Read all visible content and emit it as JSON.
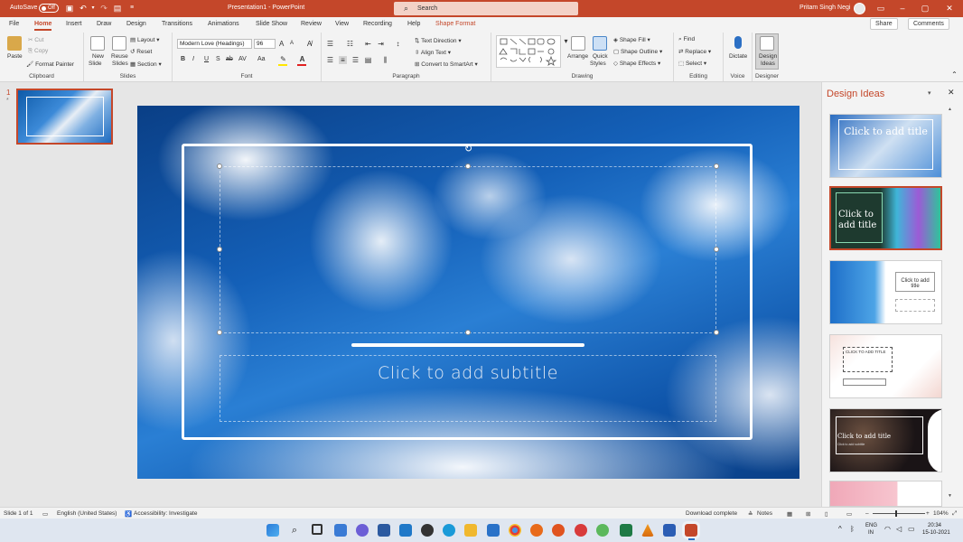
{
  "titlebar": {
    "autosave": "AutoSave",
    "autosave_state": "Off",
    "title": "Presentation1 - PowerPoint",
    "search": "Search",
    "user": "Pritam Singh Negi"
  },
  "tabs": [
    "File",
    "Home",
    "Insert",
    "Draw",
    "Design",
    "Transitions",
    "Animations",
    "Slide Show",
    "Review",
    "View",
    "Recording",
    "Help",
    "Shape Format"
  ],
  "tab_buttons": {
    "share": "Share",
    "comments": "Comments"
  },
  "ribbon": {
    "clipboard": {
      "label": "Clipboard",
      "paste": "Paste",
      "cut": "Cut",
      "copy": "Copy",
      "format_painter": "Format Painter"
    },
    "slides": {
      "label": "Slides",
      "new_slide": "New",
      "new_slide2": "Slide",
      "reuse": "Reuse",
      "reuse2": "Slides",
      "layout": "Layout",
      "reset": "Reset",
      "section": "Section"
    },
    "font": {
      "label": "Font",
      "family": "Modern Love (Headings)",
      "size": "96",
      "bold": "B",
      "italic": "I",
      "underline": "U",
      "strike": "S",
      "shadow": "ab",
      "spacing": "AV",
      "case": "Aa",
      "grow": "A",
      "shrink": "A"
    },
    "paragraph": {
      "label": "Paragraph",
      "text_direction": "Text Direction",
      "align_text": "Align Text",
      "smartart": "Convert to SmartArt"
    },
    "drawing": {
      "label": "Drawing",
      "arrange": "Arrange",
      "quick_styles": "Quick",
      "quick_styles2": "Styles",
      "shape_fill": "Shape Fill",
      "shape_outline": "Shape Outline",
      "shape_effects": "Shape Effects"
    },
    "editing": {
      "label": "Editing",
      "find": "Find",
      "replace": "Replace",
      "select": "Select"
    },
    "voice": {
      "label": "Voice",
      "dictate": "Dictate"
    },
    "designer": {
      "label": "Designer",
      "design_ideas": "Design",
      "design_ideas2": "Ideas"
    }
  },
  "slides_pane": {
    "slide_number": "1",
    "star": "*"
  },
  "slide": {
    "subtitle_placeholder": "Click to add subtitle"
  },
  "design_pane": {
    "title": "Design Ideas",
    "ideas": [
      {
        "title": "Click to add title"
      },
      {
        "title": "Click to add title"
      },
      {
        "title": "Click to add title"
      },
      {
        "title": "CLICK TO ADD TITLE"
      },
      {
        "title": "Click to add title",
        "sub": "Click to add subtitle"
      }
    ]
  },
  "status": {
    "slide": "Slide 1 of 1",
    "language": "English (United States)",
    "accessibility": "Accessibility: Investigate",
    "download": "Download complete",
    "notes": "Notes",
    "zoom": "104%"
  },
  "taskbar": {
    "lang": "ENG",
    "lang2": "IN",
    "time": "20:34",
    "date": "15-10-2021"
  },
  "colors": {
    "accent": "#c4472a",
    "taskbar": "#dfe6f0"
  }
}
